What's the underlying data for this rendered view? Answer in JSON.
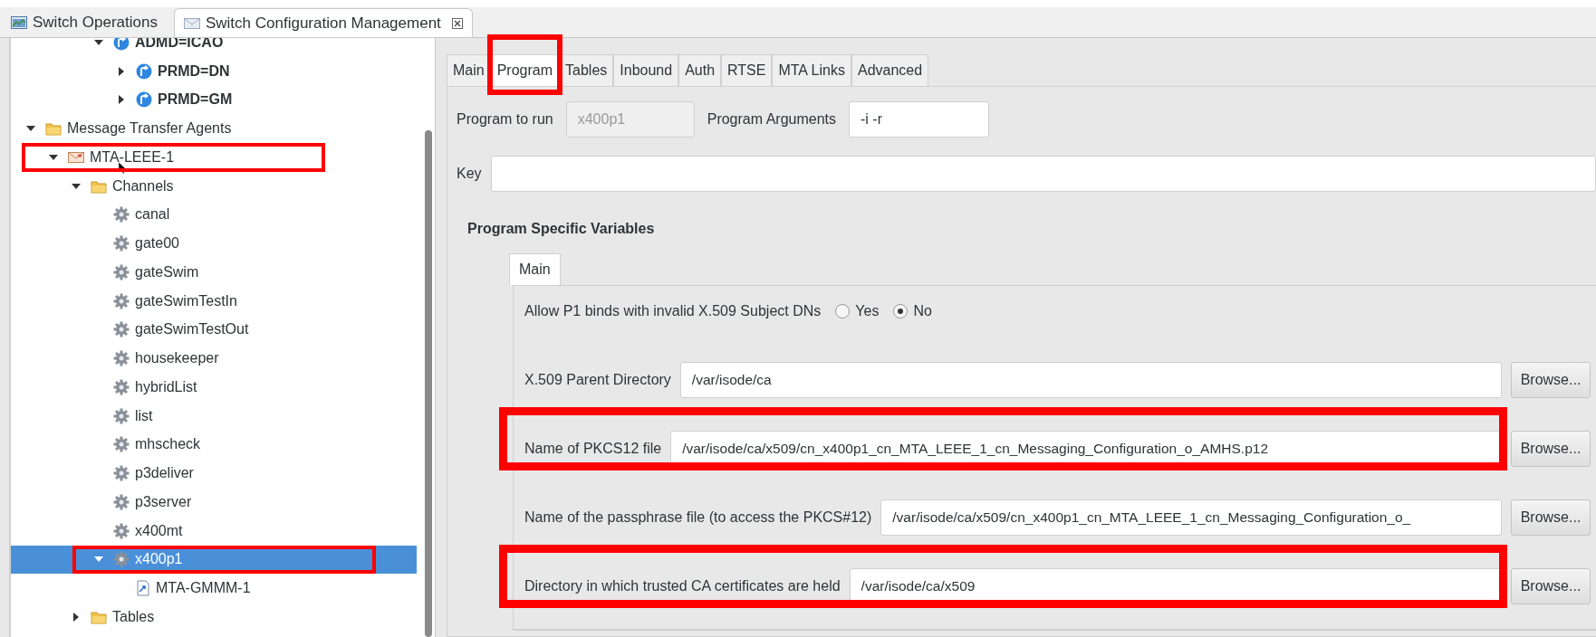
{
  "tabs": [
    {
      "label": "Switch Operations",
      "kind": "operations",
      "selected": false,
      "closable": false
    },
    {
      "label": "Switch Configuration Management",
      "kind": "config",
      "selected": true,
      "closable": true
    }
  ],
  "tree": {
    "continued": [
      {
        "label": "ADMD=ICAO",
        "kind": "domain",
        "bold": true,
        "selected": false,
        "expanded": true,
        "children": [
          {
            "label": "PRMD=DN",
            "kind": "domain",
            "bold": true,
            "selected": false,
            "expanded": false
          },
          {
            "label": "PRMD=GM",
            "kind": "domain",
            "bold": true,
            "selected": false,
            "expanded": false
          }
        ]
      }
    ],
    "items": [
      {
        "label": "Message Transfer Agents",
        "kind": "folder",
        "bold": false,
        "selected": false,
        "expanded": true,
        "children": [
          {
            "label": "MTA-LEEE-1",
            "kind": "mta",
            "bold": false,
            "selected": false,
            "expanded": true,
            "highlighted": true,
            "children": [
              {
                "label": "Channels",
                "kind": "folder",
                "bold": false,
                "selected": false,
                "expanded": true,
                "children": [
                  {
                    "label": "canal",
                    "kind": "channel",
                    "bold": false,
                    "selected": false
                  },
                  {
                    "label": "gate00",
                    "kind": "channel",
                    "bold": false,
                    "selected": false
                  },
                  {
                    "label": "gateSwim",
                    "kind": "channel",
                    "bold": false,
                    "selected": false
                  },
                  {
                    "label": "gateSwimTestIn",
                    "kind": "channel",
                    "bold": false,
                    "selected": false
                  },
                  {
                    "label": "gateSwimTestOut",
                    "kind": "channel",
                    "bold": false,
                    "selected": false
                  },
                  {
                    "label": "housekeeper",
                    "kind": "channel",
                    "bold": false,
                    "selected": false
                  },
                  {
                    "label": "hybridList",
                    "kind": "channel",
                    "bold": false,
                    "selected": false
                  },
                  {
                    "label": "list",
                    "kind": "channel",
                    "bold": false,
                    "selected": false
                  },
                  {
                    "label": "mhscheck",
                    "kind": "channel",
                    "bold": false,
                    "selected": false
                  },
                  {
                    "label": "p3deliver",
                    "kind": "channel",
                    "bold": false,
                    "selected": false
                  },
                  {
                    "label": "p3server",
                    "kind": "channel",
                    "bold": false,
                    "selected": false
                  },
                  {
                    "label": "x400mt",
                    "kind": "channel",
                    "bold": false,
                    "selected": false
                  },
                  {
                    "label": "x400p1",
                    "kind": "channel",
                    "bold": false,
                    "selected": true,
                    "expanded": true,
                    "highlighted": true,
                    "children": [
                      {
                        "label": "MTA-GMMM-1",
                        "kind": "link",
                        "bold": false,
                        "selected": false
                      }
                    ]
                  }
                ]
              },
              {
                "label": "Tables",
                "kind": "folder",
                "bold": false,
                "selected": false,
                "expanded": false
              }
            ]
          }
        ]
      }
    ]
  },
  "editor": {
    "tabs": [
      {
        "label": "Main",
        "selected": false
      },
      {
        "label": "Program",
        "selected": true,
        "highlighted": true
      },
      {
        "label": "Tables",
        "selected": false
      },
      {
        "label": "Inbound",
        "selected": false
      },
      {
        "label": "Auth",
        "selected": false
      },
      {
        "label": "RTSE",
        "selected": false
      },
      {
        "label": "MTA Links",
        "selected": false
      },
      {
        "label": "Advanced",
        "selected": false
      }
    ],
    "program_to_run": {
      "label": "Program to run",
      "value": "x400p1",
      "disabled": true
    },
    "program_arguments": {
      "label": "Program Arguments",
      "value": "-i -r",
      "disabled": false
    },
    "key": {
      "label": "Key"
    },
    "section_title": "Program Specific Variables",
    "subtabs": [
      {
        "label": "Main",
        "selected": true
      }
    ],
    "settings": [
      {
        "kind": "radio",
        "label": "Allow P1 binds with invalid X.509 Subject DNs",
        "options": [
          {
            "label": "Yes",
            "selected": false
          },
          {
            "label": "No",
            "selected": true
          }
        ]
      },
      {
        "kind": "path",
        "label": "X.509 Parent Directory",
        "value": "/var/isode/ca",
        "button": "Browse..."
      },
      {
        "kind": "path",
        "label": "Name of PKCS12 file",
        "value": "/var/isode/ca/x509/cn_x400p1_cn_MTA_LEEE_1_cn_Messaging_Configuration_o_AMHS.p12",
        "button": "Browse...",
        "highlighted": true
      },
      {
        "kind": "path",
        "label": "Name of the passphrase file (to access the PKCS#12)",
        "value": "/var/isode/ca/x509/cn_x400p1_cn_MTA_LEEE_1_cn_Messaging_Configuration_o_",
        "button": "Browse..."
      },
      {
        "kind": "path",
        "label": "Directory in which trusted CA certificates are held",
        "value": "/var/isode/ca/x509",
        "button": "Browse...",
        "highlighted": true
      }
    ]
  }
}
